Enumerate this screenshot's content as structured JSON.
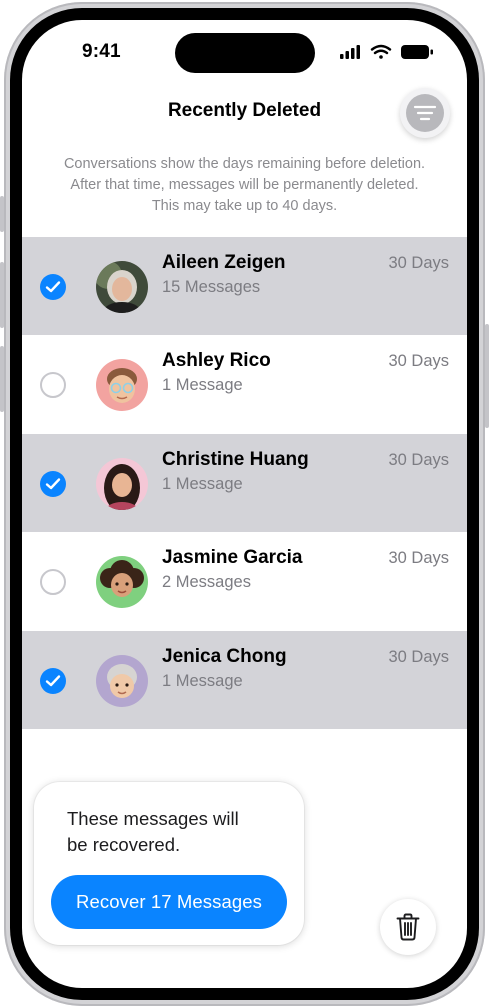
{
  "status_bar": {
    "time": "9:41"
  },
  "header": {
    "title": "Recently Deleted"
  },
  "info": {
    "line1": "Conversations show the days remaining before deletion.",
    "line2": "After that time, messages will be permanently deleted.",
    "line3": "This may take up to 40 days."
  },
  "conversations": [
    {
      "name": "Aileen Zeigen",
      "count": "15 Messages",
      "days": "30 Days",
      "selected": true
    },
    {
      "name": "Ashley Rico",
      "count": "1 Message",
      "days": "30 Days",
      "selected": false
    },
    {
      "name": "Christine Huang",
      "count": "1 Message",
      "days": "30 Days",
      "selected": true
    },
    {
      "name": "Jasmine Garcia",
      "count": "2 Messages",
      "days": "30 Days",
      "selected": false
    },
    {
      "name": "Jenica Chong",
      "count": "1 Message",
      "days": "30 Days",
      "selected": true
    }
  ],
  "popup": {
    "line1": "These messages will",
    "line2": "be recovered.",
    "button_label": "Recover 17 Messages"
  },
  "icons": {
    "filter": "filter-icon",
    "trash": "trash-icon",
    "checkmark": "checkmark-icon"
  },
  "colors": {
    "accent": "#0a84ff",
    "selected_row": "#d3d3d8",
    "secondary_text": "#7c7c82"
  }
}
